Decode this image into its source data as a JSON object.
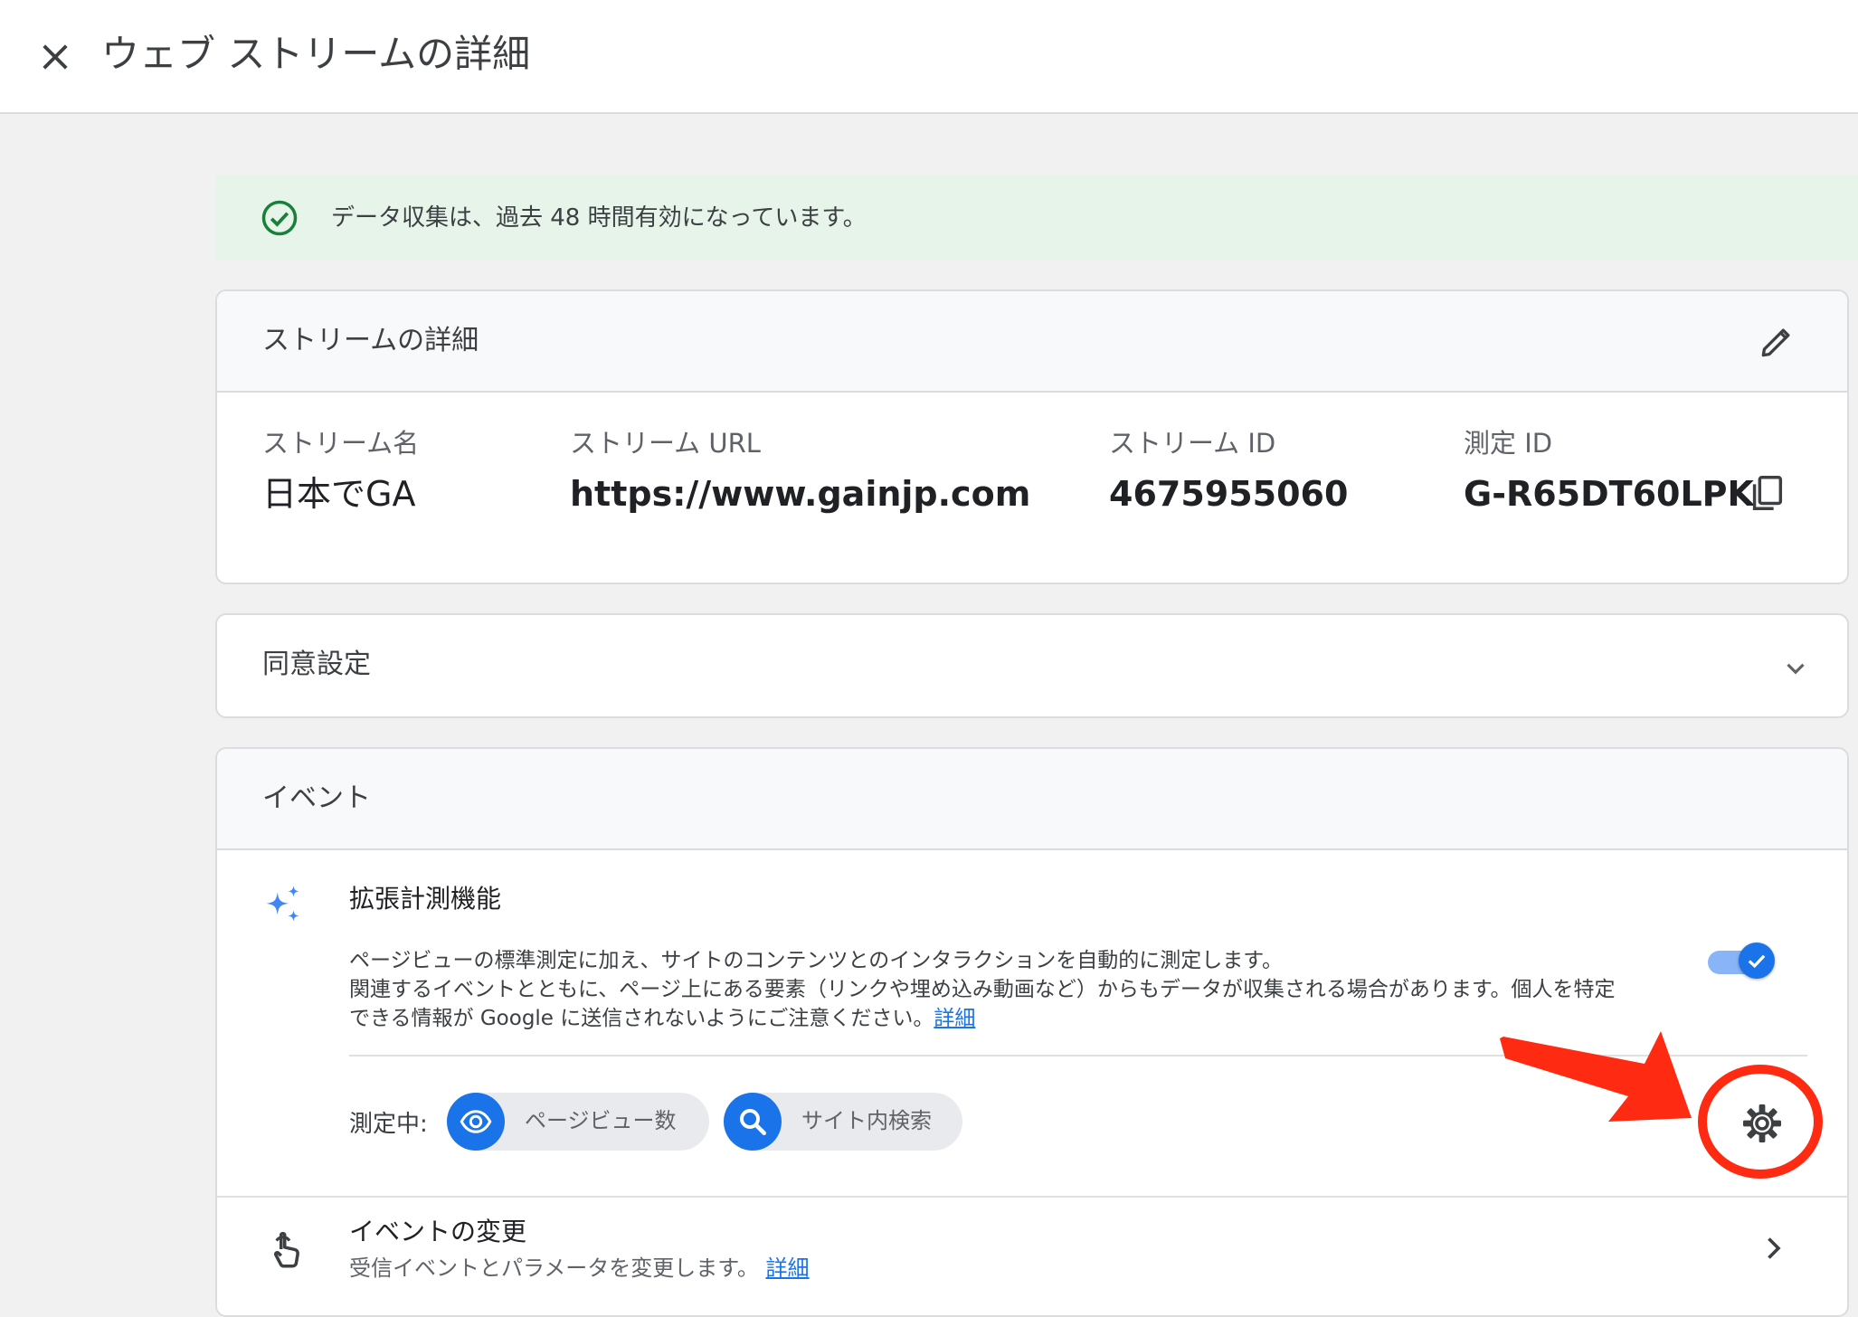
{
  "header": {
    "title": "ウェブ ストリームの詳細"
  },
  "banner": {
    "text": "データ収集は、過去 48 時間有効になっています。"
  },
  "stream_details": {
    "title": "ストリームの詳細",
    "fields": [
      {
        "label": "ストリーム名",
        "value": "日本でGA"
      },
      {
        "label": "ストリーム URL",
        "value": "https://www.gainjp.com"
      },
      {
        "label": "ストリーム ID",
        "value": "4675955060"
      },
      {
        "label": "測定 ID",
        "value": "G-R65DT60LPK"
      }
    ]
  },
  "consent": {
    "title": "同意設定"
  },
  "events": {
    "title": "イベント",
    "enhanced_measurement": {
      "title": "拡張計測機能",
      "description": "ページビューの標準測定に加え、サイトのコンテンツとのインタラクションを自動的に測定します。\n関連するイベントとともに、ページ上にある要素（リンクや埋め込み動画など）からもデータが収集される場合があります。個人を特定\nできる情報が Google に送信されないようにご注意ください。",
      "link_text": "詳細",
      "toggle_on": true,
      "measuring_label": "測定中:",
      "chips": [
        {
          "label": "ページビュー数",
          "icon": "eye-icon"
        },
        {
          "label": "サイト内検索",
          "icon": "search-icon"
        }
      ]
    },
    "modify_events": {
      "title": "イベントの変更",
      "description": "受信イベントとパラメータを変更します。",
      "link_text": "詳細"
    }
  },
  "colors": {
    "accent": "#1a73e8",
    "success": "#188038",
    "banner_bg": "#e6f4ea",
    "annotation": "#ff2a12"
  }
}
